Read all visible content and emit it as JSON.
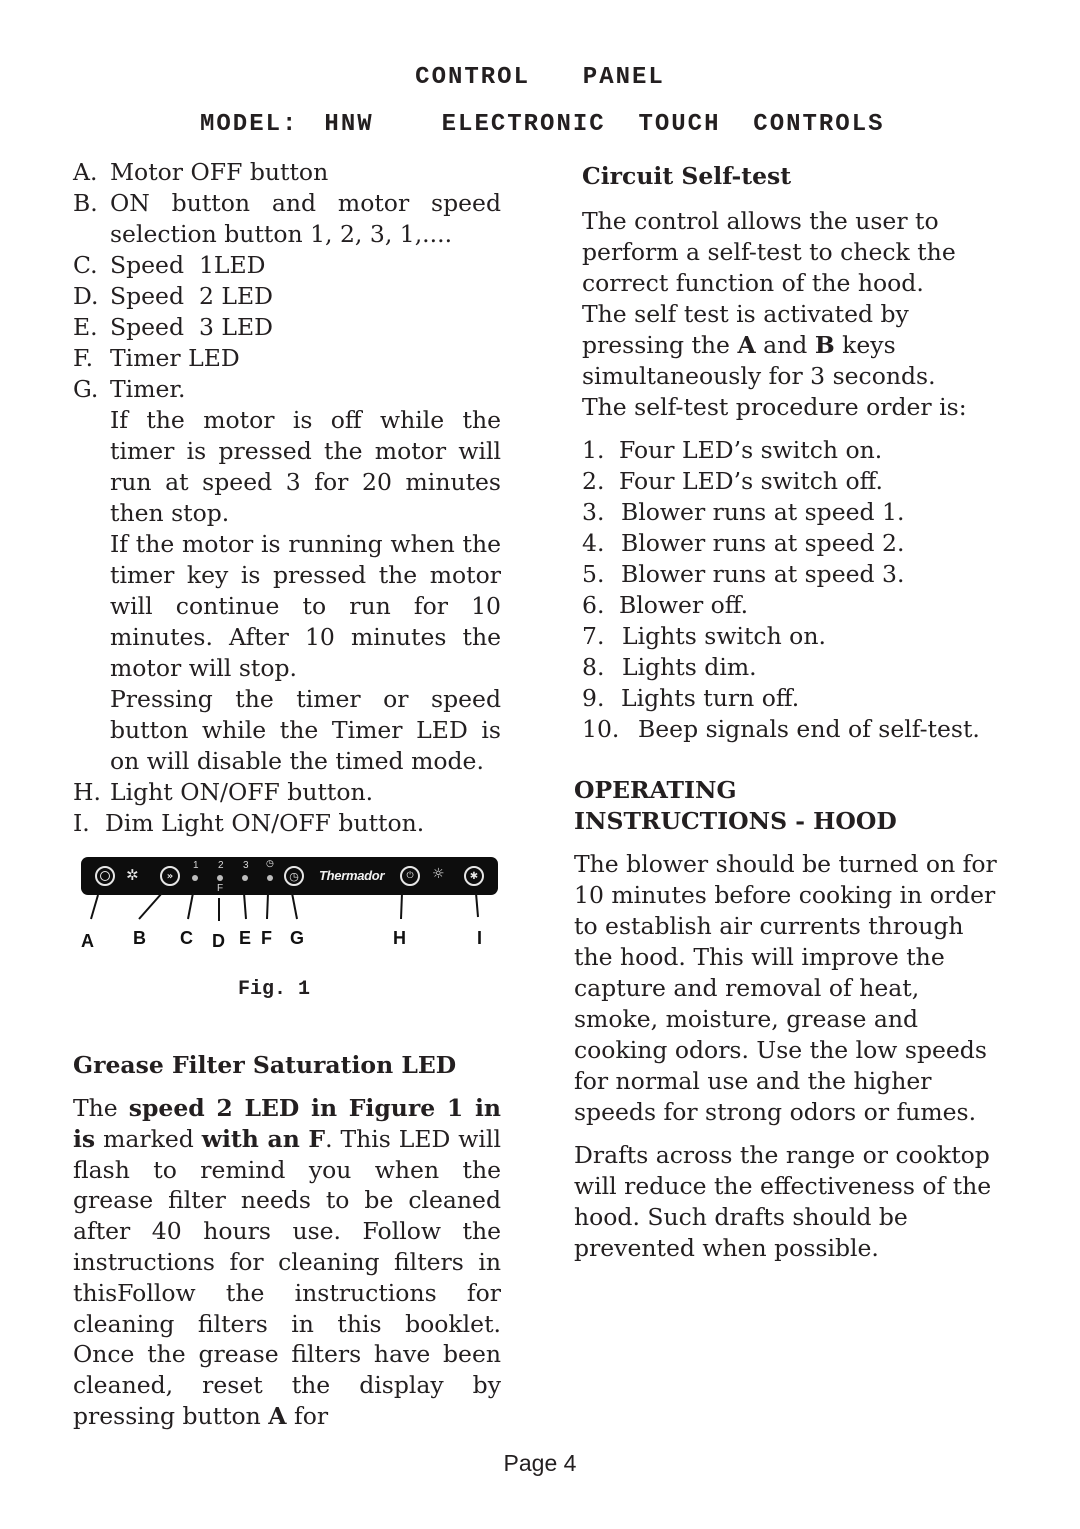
{
  "header": {
    "title": "CONTROL  PANEL",
    "model_label": "MODEL:",
    "model_value": "HNW",
    "subtitle": "ELECTRONIC  TOUCH  CONTROLS"
  },
  "legend_items": [
    {
      "key": "A.",
      "text": "Motor OFF button"
    },
    {
      "key": "B.",
      "text": "ON button and motor speed selection button 1, 2, 3, 1,...."
    },
    {
      "key": "C.",
      "text": "Speed  1LED"
    },
    {
      "key": "D.",
      "text": "Speed  2 LED"
    },
    {
      "key": "E.",
      "text": "Speed  3 LED"
    },
    {
      "key": "F.",
      "text": "Timer LED"
    },
    {
      "key": "G.",
      "text": "Timer."
    }
  ],
  "timer_paragraphs": [
    "If the motor is off while the timer is pressed the motor will run at speed 3 for 20 minutes then stop.",
    "If the motor is running when the timer key is pressed the motor will continue to run for 10 minutes.  After 10 minutes the motor will stop.",
    "Pressing the timer or speed button while the Timer LED is on will disable the timed mode."
  ],
  "legend_items_2": [
    {
      "key": "H.",
      "text": "Light ON/OFF button."
    },
    {
      "key": "I.",
      "text": "Dim Light ON/OFF button."
    }
  ],
  "figure": {
    "caption": "Fig. 1",
    "brand": "Thermador",
    "led_labels": [
      "1",
      "2",
      "3"
    ],
    "filter_mark": "F",
    "timer_led_icon": "clock-icon",
    "buttons": [
      {
        "id": "A",
        "icon": "motor-off-icon"
      },
      {
        "id": "B",
        "icon": "speed-forward-icon"
      },
      {
        "id": "G",
        "icon": "timer-icon"
      },
      {
        "id": "H",
        "icon": "light-power-icon"
      },
      {
        "id": "I",
        "icon": "dim-light-icon"
      }
    ],
    "callout_letters": [
      "A",
      "B",
      "C",
      "D",
      "E",
      "F",
      "G",
      "H",
      "I"
    ]
  },
  "grease": {
    "heading": "Grease Filter Saturation LED",
    "p_the": "The ",
    "p_bold1": "speed 2 LED in Figure 1 in is",
    "p_marked": "marked ",
    "p_bold2": "with an F",
    "p_rest": ". This LED will flash to remind you when the grease filter needs to be cleaned after 40 hours use. Follow the instructions for cleaning filters in thisFollow the instructions for cleaning filters in this booklet.  Once the grease filters have been cleaned, reset the display by pressing button ",
    "p_bold3": "A",
    "p_end": " for"
  },
  "selftest": {
    "heading": "Circuit Self-test",
    "p1": "The control allows the user to perform a self-test to check the correct function of the hood.",
    "p2_a": "The self test is activated by pressing the ",
    "p2_b1": "A",
    "p2_and": " and ",
    "p2_b2": "B",
    "p2_c": " keys simultaneously for 3 seconds.",
    "p3": "The self-test procedure order is:",
    "steps": [
      {
        "n": "1.",
        "text": "Four LED’s switch on."
      },
      {
        "n": "2.",
        "text": "Four LED’s switch off."
      },
      {
        "n": "3.",
        "text": "Blower runs at speed 1."
      },
      {
        "n": "4.",
        "text": "Blower runs at speed 2."
      },
      {
        "n": "5.",
        "text": "Blower runs at speed 3."
      },
      {
        "n": "6.",
        "text": "Blower off."
      },
      {
        "n": "7.",
        "text": "Lights switch on."
      },
      {
        "n": "8.",
        "text": "Lights dim."
      },
      {
        "n": "9.",
        "text": "Lights turn off."
      },
      {
        "n": "10.",
        "text": "Beep signals end of self-test."
      }
    ]
  },
  "operating": {
    "heading_line1": "OPERATING",
    "heading_line2": "INSTRUCTIONS - HOOD",
    "p1": "The blower should be turned on for 10 minutes before cooking in order to establish air currents through the hood.  This will improve the capture and removal of heat, smoke, moisture, grease and cooking odors.  Use the low speeds for normal use and the higher speeds for strong odors or fumes.",
    "p2": "Drafts across the range or cooktop will reduce the effectiveness of the hood.  Such drafts should be prevented when possible."
  },
  "footer": {
    "page": "Page 4"
  }
}
